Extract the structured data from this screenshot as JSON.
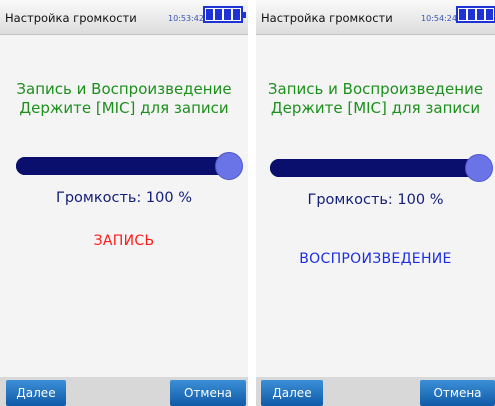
{
  "screens": [
    {
      "app_title": "Настройка громкости",
      "clock": "10:53:42",
      "battery": {
        "level": 1.0
      },
      "heading_line1": "Запись и Воспроизведение",
      "heading_line2": "Держите [MIC] для записи",
      "volume": {
        "label": "Громкость: 100 %",
        "level": 1.0
      },
      "mode": {
        "text": "ЗАПИСЬ",
        "color": "#ff1a1a"
      },
      "buttons": {
        "next": "Далее",
        "cancel": "Отмена"
      }
    },
    {
      "app_title": "Настройка громкости",
      "clock": "10:54:24",
      "battery": {
        "level": 1.0
      },
      "heading_line1": "Запись и Воспроизведение",
      "heading_line2": "Держите [MIC] для записи",
      "volume": {
        "label": "Громкость: 100 %",
        "level": 1.0
      },
      "mode": {
        "text": "ВОСПРОИЗВЕДЕНИЕ",
        "color": "#1d2ee0"
      },
      "buttons": {
        "next": "Далее",
        "cancel": "Отмена"
      }
    }
  ],
  "colors": {
    "heading": "#1d8f1d",
    "slider_track": "#0a0f6e",
    "slider_knob": "#6b74e6",
    "softkey": "#1f6fbf",
    "battery": "#1d33d8"
  }
}
